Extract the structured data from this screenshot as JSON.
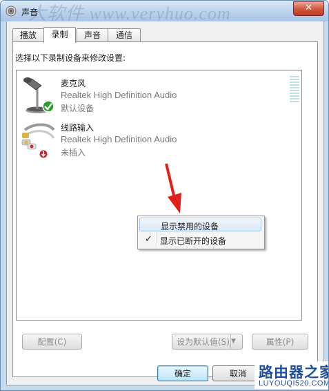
{
  "window": {
    "title": "声音",
    "close_label": "✕",
    "watermark": "大软件 www.veryhuo.com"
  },
  "tabs": [
    {
      "label": "播放",
      "active": false
    },
    {
      "label": "录制",
      "active": true
    },
    {
      "label": "声音",
      "active": false
    },
    {
      "label": "通信",
      "active": false
    }
  ],
  "panel": {
    "instruction": "选择以下录制设备来修改设置:"
  },
  "devices": [
    {
      "name": "麦克风",
      "driver": "Realtek High Definition Audio",
      "status": "默认设备",
      "icon": "microphone-icon",
      "badge": "default-check-icon"
    },
    {
      "name": "线路输入",
      "driver": "Realtek High Definition Audio",
      "status": "未插入",
      "icon": "rca-cable-icon",
      "badge": "unplugged-icon"
    }
  ],
  "context_menu": {
    "items": [
      {
        "label": "显示禁用的设备",
        "checked": false,
        "highlighted": true
      },
      {
        "label": "显示已断开的设备",
        "checked": true,
        "highlighted": false
      }
    ],
    "check_glyph": "✓"
  },
  "buttons": {
    "configure": "配置(C)",
    "set_default": "设为默认值(S)",
    "properties": "属性(P)",
    "ok": "确定",
    "cancel": "取消"
  },
  "site_watermark": {
    "text_cn": "路由器之家",
    "text_en": "LUYOUQI520.COM"
  },
  "colors": {
    "accent": "#3c7fb1",
    "check_green": "#1f9a1f",
    "unplugged_red": "#c0252a",
    "arrow_red": "#e0201c"
  }
}
